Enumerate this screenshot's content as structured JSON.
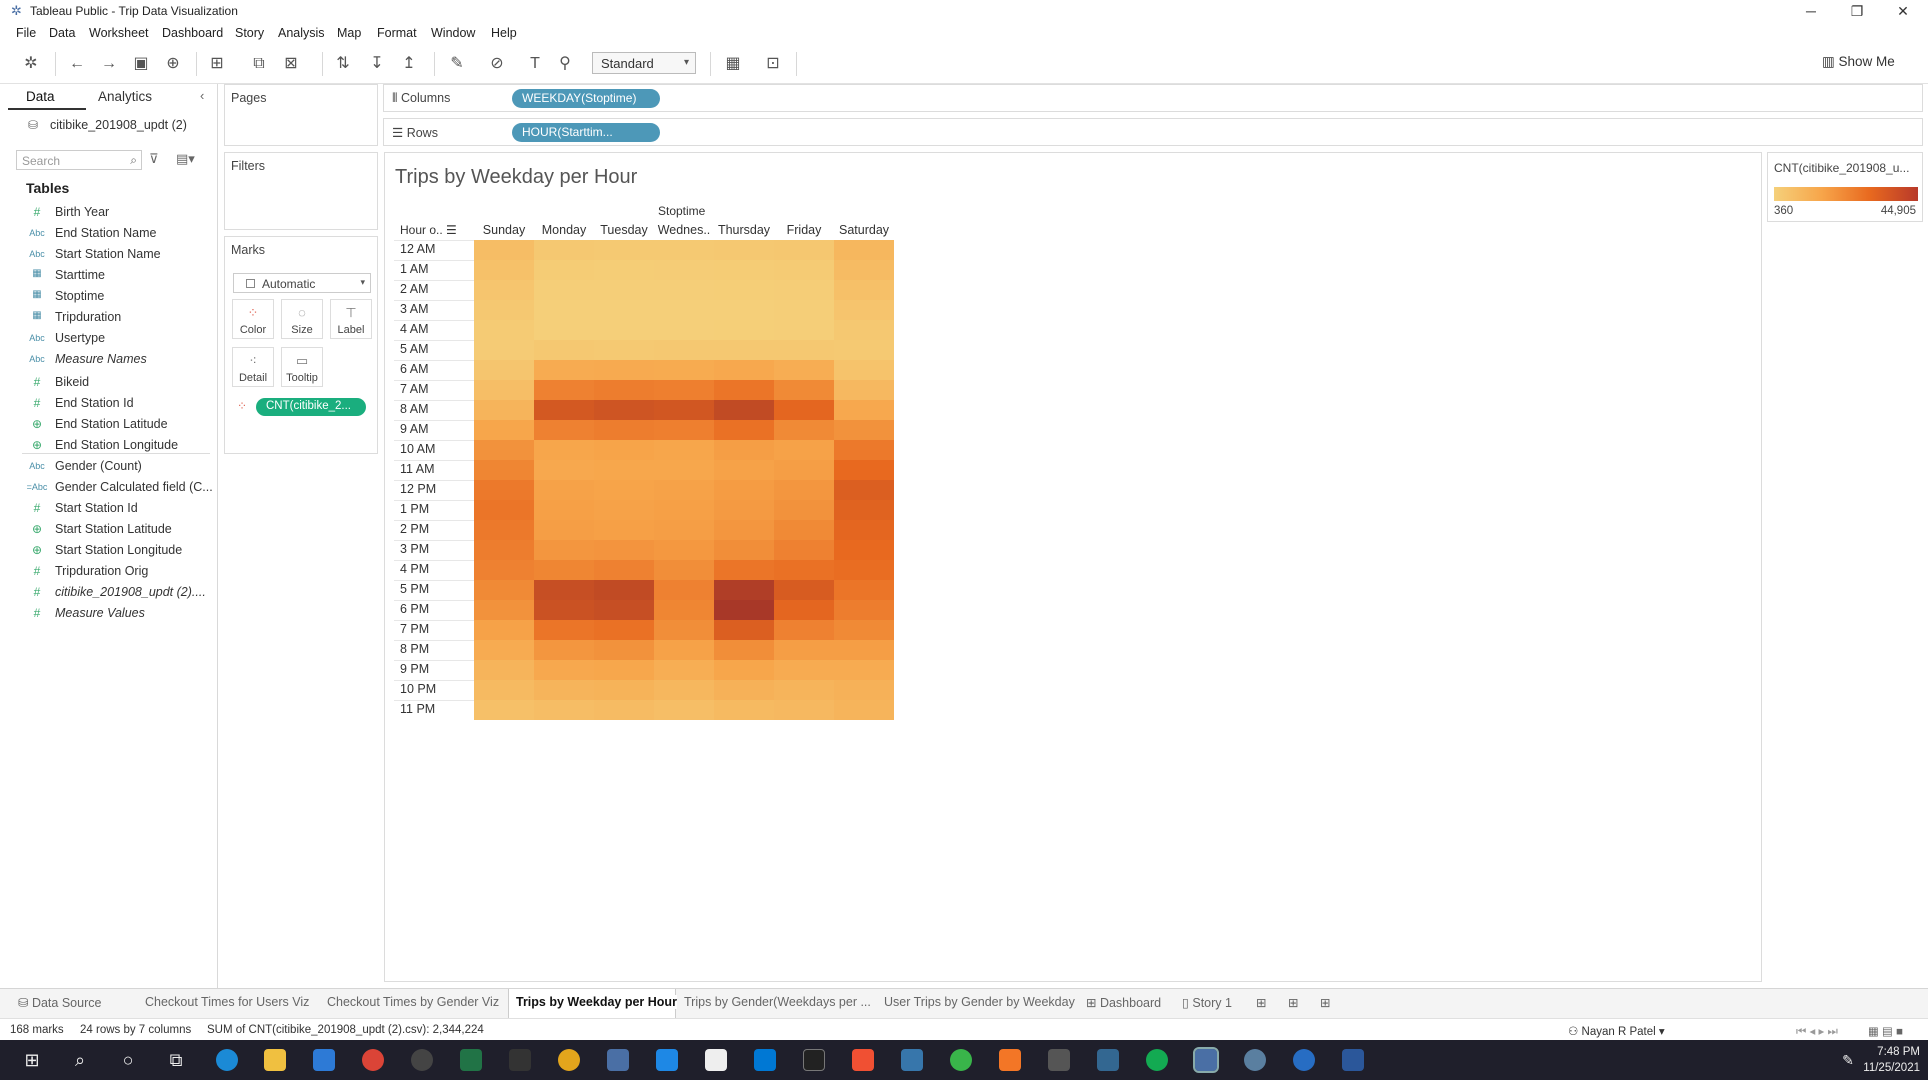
{
  "window": {
    "title": "Tableau Public - Trip Data Visualization"
  },
  "menu": [
    "File",
    "Data",
    "Worksheet",
    "Dashboard",
    "Story",
    "Analysis",
    "Map",
    "Format",
    "Window",
    "Help"
  ],
  "toolbar": {
    "fit": "Standard",
    "show_me": "Show Me"
  },
  "datapane": {
    "tab_data": "Data",
    "tab_analytics": "Analytics",
    "datasource": "citibike_201908_updt (2)",
    "search_placeholder": "Search",
    "tables_heading": "Tables",
    "fields": [
      {
        "type": "#",
        "name": "Birth Year",
        "italic": false
      },
      {
        "type": "Abc",
        "name": "End Station Name",
        "italic": false
      },
      {
        "type": "Abc",
        "name": "Start Station Name",
        "italic": false
      },
      {
        "type": "date",
        "name": "Starttime",
        "italic": false
      },
      {
        "type": "date",
        "name": "Stoptime",
        "italic": false
      },
      {
        "type": "date",
        "name": "Tripduration",
        "italic": false
      },
      {
        "type": "Abc",
        "name": "Usertype",
        "italic": false
      },
      {
        "type": "Abc",
        "name": "Measure Names",
        "italic": true
      },
      {
        "type": "#",
        "name": "Bikeid",
        "italic": false
      },
      {
        "type": "#",
        "name": "End Station Id",
        "italic": false
      },
      {
        "type": "geo",
        "name": "End Station Latitude",
        "italic": false
      },
      {
        "type": "geo",
        "name": "End Station Longitude",
        "italic": false
      },
      {
        "type": "Abc",
        "name": "Gender (Count)",
        "italic": false
      },
      {
        "type": "=Abc",
        "name": "Gender Calculated field (C...",
        "italic": false
      },
      {
        "type": "#",
        "name": "Start Station Id",
        "italic": false
      },
      {
        "type": "geo",
        "name": "Start Station Latitude",
        "italic": false
      },
      {
        "type": "geo",
        "name": "Start Station Longitude",
        "italic": false
      },
      {
        "type": "#",
        "name": "Tripduration Orig",
        "italic": false
      },
      {
        "type": "#",
        "name": "citibike_201908_updt (2)....",
        "italic": true
      },
      {
        "type": "#",
        "name": "Measure Values",
        "italic": true
      }
    ]
  },
  "cards": {
    "pages": "Pages",
    "filters": "Filters",
    "marks": "Marks",
    "mark_type": "Automatic",
    "buttons": [
      "Color",
      "Size",
      "Label",
      "Detail",
      "Tooltip"
    ],
    "color_pill": "CNT(citibike_2..."
  },
  "shelves": {
    "columns_label": "Columns",
    "columns_pill": "WEEKDAY(Stoptime)",
    "rows_label": "Rows",
    "rows_pill": "HOUR(Starttim..."
  },
  "viz": {
    "title": "Trips by Weekday per Hour",
    "col_axis_title": "Stoptime",
    "row_header": "Hour o..",
    "columns": [
      "Sunday",
      "Monday",
      "Tuesday",
      "Wednes..",
      "Thursday",
      "Friday",
      "Saturday"
    ],
    "rows": [
      "12 AM",
      "1 AM",
      "2 AM",
      "3 AM",
      "4 AM",
      "5 AM",
      "6 AM",
      "7 AM",
      "8 AM",
      "9 AM",
      "10 AM",
      "11 AM",
      "12 PM",
      "1 PM",
      "2 PM",
      "3 PM",
      "4 PM",
      "5 PM",
      "6 PM",
      "7 PM",
      "8 PM",
      "9 PM",
      "10 PM",
      "11 PM"
    ]
  },
  "chart_data": {
    "type": "heatmap",
    "title": "Trips by Weekday per Hour",
    "xlabel": "Stoptime",
    "ylabel": "Hour o..",
    "x": [
      "Sunday",
      "Monday",
      "Tuesday",
      "Wednes..",
      "Thursday",
      "Friday",
      "Saturday"
    ],
    "y": [
      "12 AM",
      "1 AM",
      "2 AM",
      "3 AM",
      "4 AM",
      "5 AM",
      "6 AM",
      "7 AM",
      "8 AM",
      "9 AM",
      "10 AM",
      "11 AM",
      "12 PM",
      "1 PM",
      "2 PM",
      "3 PM",
      "4 PM",
      "5 PM",
      "6 PM",
      "7 PM",
      "8 PM",
      "9 PM",
      "10 PM",
      "11 PM"
    ],
    "values": [
      [
        7000,
        3000,
        2800,
        2900,
        3200,
        3500,
        9000
      ],
      [
        5500,
        1800,
        1500,
        1600,
        1900,
        2100,
        7500
      ],
      [
        4200,
        1100,
        1000,
        1050,
        1200,
        1400,
        6000
      ],
      [
        3000,
        700,
        650,
        680,
        800,
        900,
        4500
      ],
      [
        2200,
        800,
        750,
        780,
        850,
        900,
        3200
      ],
      [
        2000,
        3000,
        2900,
        3000,
        3100,
        3000,
        2800
      ],
      [
        4000,
        13000,
        13500,
        13200,
        14000,
        12500,
        5000
      ],
      [
        6500,
        24000,
        25000,
        24500,
        27000,
        22000,
        8500
      ],
      [
        10000,
        35000,
        36000,
        35500,
        39000,
        31000,
        14000
      ],
      [
        15000,
        24000,
        25000,
        24500,
        28000,
        22000,
        20000
      ],
      [
        20000,
        15000,
        15500,
        15000,
        17000,
        16000,
        26000
      ],
      [
        23000,
        14000,
        14500,
        14500,
        16000,
        17000,
        30000
      ],
      [
        26000,
        16000,
        15500,
        16000,
        17500,
        19000,
        33000
      ],
      [
        27000,
        16500,
        16000,
        16500,
        18000,
        20000,
        32000
      ],
      [
        26000,
        17000,
        16500,
        17000,
        19000,
        22000,
        31000
      ],
      [
        25000,
        19000,
        19500,
        18500,
        21000,
        24000,
        30000
      ],
      [
        24000,
        23000,
        24000,
        21000,
        27000,
        28000,
        29000
      ],
      [
        22000,
        38000,
        39000,
        24000,
        43000,
        34000,
        27000
      ],
      [
        20000,
        37000,
        38000,
        23000,
        44905,
        31000,
        25000
      ],
      [
        16000,
        27000,
        28000,
        21000,
        33000,
        24000,
        22000
      ],
      [
        13000,
        19000,
        20000,
        16000,
        21000,
        17000,
        17000
      ],
      [
        10000,
        14000,
        14500,
        12000,
        15000,
        13000,
        13000
      ],
      [
        8000,
        10000,
        10500,
        9000,
        11000,
        10000,
        11000
      ],
      [
        6000,
        7000,
        7500,
        6500,
        8000,
        8500,
        10000
      ]
    ],
    "color_range": [
      360,
      44905
    ],
    "legend": "CNT(citibike_201908_u..."
  },
  "legend": {
    "title": "CNT(citibike_201908_u...",
    "min": "360",
    "max": "44,905"
  },
  "sheet_tabs": {
    "data_source": "Data Source",
    "tabs": [
      "Checkout Times for Users Viz",
      "Checkout Times by Gender Viz",
      "Trips by Weekday per Hour",
      "Trips by Gender(Weekdays per ...",
      "User Trips by Gender by Weekday"
    ],
    "dashboard": "Dashboard",
    "story": "Story 1"
  },
  "status": {
    "marks": "168 marks",
    "dims": "24 rows by 7 columns",
    "sum": "SUM of CNT(citibike_201908_updt (2).csv): 2,344,224",
    "user": "Nayan R Patel"
  },
  "taskbar": {
    "time": "7:48 PM",
    "date": "11/25/2021"
  }
}
